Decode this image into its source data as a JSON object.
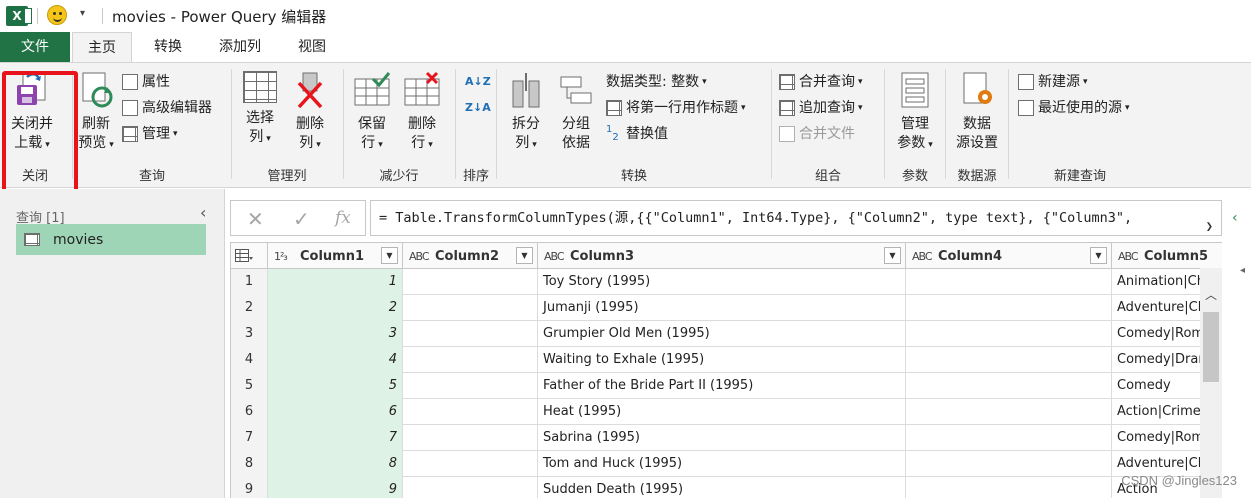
{
  "title_bar": {
    "title": "movies - Power Query 编辑器",
    "app_icon": "excel-icon",
    "qat_icon": "smiley-icon",
    "qat_more": "▾"
  },
  "tabs": [
    "文件",
    "主页",
    "转换",
    "添加列",
    "视图"
  ],
  "active_tab": "主页",
  "ribbon": {
    "close": {
      "button": "关闭并\n上载",
      "label_line1": "关闭并",
      "label_line2": "上载",
      "group": "关闭"
    },
    "query": {
      "refresh_line1": "刷新",
      "refresh_line2": "预览",
      "properties": "属性",
      "advanced_editor": "高级编辑器",
      "manage": "管理",
      "group": "查询"
    },
    "manage_columns": {
      "choose_line1": "选择",
      "choose_line2": "列",
      "remove_line1": "删除",
      "remove_line2": "列",
      "group": "管理列"
    },
    "reduce_rows": {
      "keep_line1": "保留",
      "keep_line2": "行",
      "remove_line1": "删除",
      "remove_line2": "行",
      "group": "减少行"
    },
    "sort": {
      "group": "排序"
    },
    "transform": {
      "split_line1": "拆分",
      "split_line2": "列",
      "group_by_line1": "分组",
      "group_by_line2": "依据",
      "data_type": "数据类型: 整数",
      "first_row_header": "将第一行用作标题",
      "replace_values": "替换值",
      "group": "转换"
    },
    "combine": {
      "merge_queries": "合并查询",
      "append_queries": "追加查询",
      "combine_files": "合并文件",
      "group": "组合"
    },
    "parameters": {
      "manage_line1": "管理",
      "manage_line2": "参数",
      "group": "参数"
    },
    "data_sources": {
      "settings_line1": "数据",
      "settings_line2": "源设置",
      "group": "数据源"
    },
    "new_query": {
      "new_source": "新建源",
      "recent_sources": "最近使用的源",
      "group": "新建查询"
    }
  },
  "query_pane": {
    "header": "查询 [1]",
    "items": [
      {
        "name": "movies",
        "selected": true
      }
    ]
  },
  "formula_bar": {
    "cancel": "✕",
    "confirm": "✓",
    "fx": "fx",
    "formula": "= Table.TransformColumnTypes(源,{{\"Column1\", Int64.Type}, {\"Column2\", type text}, {\"Column3\","
  },
  "grid": {
    "columns": [
      {
        "type_label": "1²₃",
        "name": "Column1"
      },
      {
        "type_label": "ABC",
        "name": "Column2"
      },
      {
        "type_label": "ABC",
        "name": "Column3"
      },
      {
        "type_label": "ABC",
        "name": "Column4"
      },
      {
        "type_label": "ABC",
        "name": "Column5"
      }
    ],
    "rows": [
      {
        "num": "1",
        "c1": "1",
        "c2": "",
        "c3": "Toy Story (1995)",
        "c4": "",
        "c5": "Animation|Ch"
      },
      {
        "num": "2",
        "c1": "2",
        "c2": "",
        "c3": "Jumanji (1995)",
        "c4": "",
        "c5": "Adventure|Ch"
      },
      {
        "num": "3",
        "c1": "3",
        "c2": "",
        "c3": "Grumpier Old Men (1995)",
        "c4": "",
        "c5": "Comedy|Roma"
      },
      {
        "num": "4",
        "c1": "4",
        "c2": "",
        "c3": "Waiting to Exhale (1995)",
        "c4": "",
        "c5": "Comedy|Dram"
      },
      {
        "num": "5",
        "c1": "5",
        "c2": "",
        "c3": "Father of the Bride Part II (1995)",
        "c4": "",
        "c5": "Comedy"
      },
      {
        "num": "6",
        "c1": "6",
        "c2": "",
        "c3": "Heat (1995)",
        "c4": "",
        "c5": "Action|Crime|"
      },
      {
        "num": "7",
        "c1": "7",
        "c2": "",
        "c3": "Sabrina (1995)",
        "c4": "",
        "c5": "Comedy|Roma"
      },
      {
        "num": "8",
        "c1": "8",
        "c2": "",
        "c3": "Tom and Huck (1995)",
        "c4": "",
        "c5": "Adventure|Ch"
      },
      {
        "num": "9",
        "c1": "9",
        "c2": "",
        "c3": "Sudden Death (1995)",
        "c4": "",
        "c5": "Action"
      }
    ]
  },
  "watermark": "CSDN @Jingles123",
  "colors": {
    "file_tab": "#217346",
    "highlight": "#e8141c",
    "selected_query": "#9fd5b7",
    "column1_fill": "#dff2e6"
  }
}
